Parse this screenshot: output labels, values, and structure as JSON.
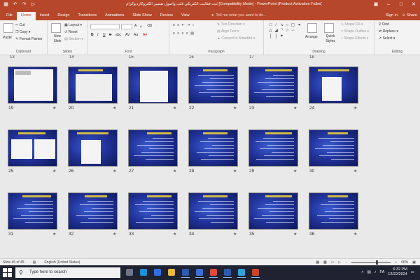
{
  "window": {
    "title": "ثبت فعالیت الکتریکی قلب واصول تفسیر الکتروکاردیوگرام [Compatibility Mode] - PowerPoint (Product Activation Failed)",
    "accent": "#b7472a"
  },
  "qat": {
    "save_icon": "save-icon",
    "undo_icon": "undo-icon",
    "redo_icon": "redo-icon",
    "present_icon": "present-icon"
  },
  "tabs": [
    {
      "label": "File"
    },
    {
      "label": "Home"
    },
    {
      "label": "Insert"
    },
    {
      "label": "Design"
    },
    {
      "label": "Transitions"
    },
    {
      "label": "Animations"
    },
    {
      "label": "Slide Show"
    },
    {
      "label": "Review"
    },
    {
      "label": "View"
    }
  ],
  "tellme": "Tell me what you want to do...",
  "signin": "Sign in",
  "share": "Share",
  "ribbon": {
    "clipboard": {
      "paste": "Paste",
      "cut": "Cut",
      "copy": "Copy",
      "format_painter": "Format Painter",
      "label": "Clipboard"
    },
    "slides": {
      "new_slide": "New Slide",
      "layout": "Layout",
      "reset": "Reset",
      "section": "Section",
      "label": "Slides"
    },
    "font": {
      "size": "A",
      "label": "Font",
      "bold": "B",
      "italic": "I",
      "underline": "U",
      "strike": "S",
      "shadow": "abc",
      "spacing": "AV",
      "case": "Aa"
    },
    "paragraph": {
      "text_direction": "Text Direction",
      "align_text": "Align Text",
      "convert_smartart": "Convert to SmartArt",
      "label": "Paragraph"
    },
    "drawing": {
      "arrange": "Arrange",
      "quick_styles": "Quick Styles",
      "shape_fill": "Shape Fill",
      "shape_outline": "Shape Outline",
      "shape_effects": "Shape Effects",
      "label": "Drawing"
    },
    "editing": {
      "find": "Find",
      "replace": "Replace",
      "select": "Select",
      "label": "Editing"
    }
  },
  "top_row_numbers": [
    "13",
    "14",
    "15",
    "16",
    "17",
    "18"
  ],
  "slides": [
    {
      "num": "19",
      "kind": "ecg-white"
    },
    {
      "num": "20",
      "kind": "ecg-grid"
    },
    {
      "num": "21",
      "kind": "ecg-paper"
    },
    {
      "num": "22",
      "kind": "text"
    },
    {
      "num": "23",
      "kind": "text"
    },
    {
      "num": "24",
      "kind": "ecg-small"
    },
    {
      "num": "25",
      "kind": "two-panels"
    },
    {
      "num": "26",
      "kind": "ecg-small"
    },
    {
      "num": "27",
      "kind": "text"
    },
    {
      "num": "28",
      "kind": "text"
    },
    {
      "num": "29",
      "kind": "text"
    },
    {
      "num": "30",
      "kind": "text"
    },
    {
      "num": "31",
      "kind": "text"
    },
    {
      "num": "32",
      "kind": "text"
    },
    {
      "num": "33",
      "kind": "text"
    },
    {
      "num": "34",
      "kind": "text"
    },
    {
      "num": "35",
      "kind": "text"
    },
    {
      "num": "36",
      "kind": "text"
    }
  ],
  "status": {
    "slide": "Slide 45 of 45",
    "language": "English (United States)",
    "zoom": "66%",
    "zoom_fraction": 0.66
  },
  "taskbar": {
    "search": "Type here to search",
    "time": "6:32 PM",
    "date": "12/22/2024",
    "lang": "FA",
    "apps": [
      {
        "name": "task-view-icon",
        "color": "#6e7488"
      },
      {
        "name": "edge-icon",
        "color": "#1e90d6"
      },
      {
        "name": "bluetooth-icon",
        "color": "#2f6fe0"
      },
      {
        "name": "file-explorer-icon",
        "color": "#e7b93d"
      },
      {
        "name": "word-icon",
        "color": "#2b5cb0"
      },
      {
        "name": "store-icon",
        "color": "#3a6fd8"
      },
      {
        "name": "chrome-icon",
        "color": "#e04a3a"
      },
      {
        "name": "word-doc-icon",
        "color": "#2b5cb0"
      },
      {
        "name": "telegram-icon",
        "color": "#2ea3dd"
      },
      {
        "name": "powerpoint-icon",
        "color": "#c8472a"
      }
    ]
  }
}
